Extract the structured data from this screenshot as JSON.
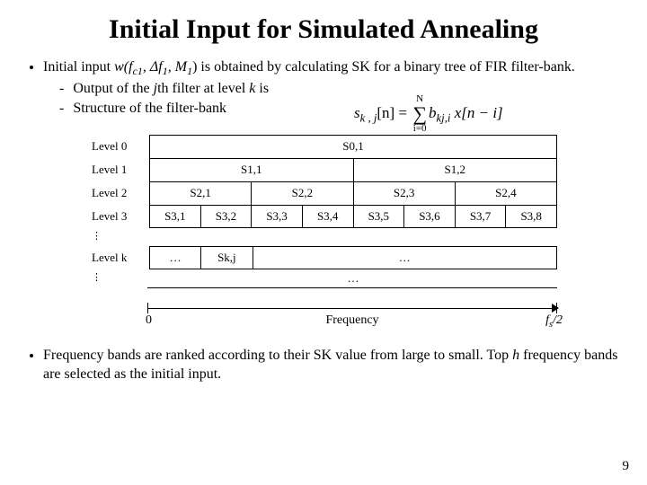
{
  "title": "Initial Input for Simulated Annealing",
  "bullets": {
    "b1_pre": "Initial input ",
    "b1_wf": "w(f",
    "b1_c1": "c1",
    "b1_mid1": ", Δf",
    "b1_one": "1",
    "b1_mid2": ", M",
    "b1_one2": "1",
    "b1_post": ") is obtained by calculating  SK for a binary tree of FIR filter-bank.",
    "s1_pre": "Output of the ",
    "s1_j": "j",
    "s1_mid": "th filter at level ",
    "s1_k": "k",
    "s1_post": " is",
    "s2": "Structure of the filter-bank",
    "b2": "Frequency bands are ranked according to their SK value from large to small. Top ",
    "b2_h": "h",
    "b2_post": " frequency bands  are selected as the initial input."
  },
  "eq": {
    "lhs_s": "s",
    "lhs_kj": "k , j",
    "lhs_n": "[n] = ",
    "sum_top": "N",
    "sum_bot": "i=0",
    "b": "b",
    "b_kji": "kj,i",
    "x": " x[n − i]"
  },
  "diagram": {
    "levels": [
      "Level 0",
      "Level 1",
      "Level 2",
      "Level 3",
      "Level k"
    ],
    "row0": [
      "S0,1"
    ],
    "row1": [
      "S1,1",
      "S1,2"
    ],
    "row2": [
      "S2,1",
      "S2,2",
      "S2,3",
      "S2,4"
    ],
    "row3": [
      "S3,1",
      "S3,2",
      "S3,3",
      "S3,4",
      "S3,5",
      "S3,6",
      "S3,7",
      "S3,8"
    ],
    "rowk": [
      "…",
      "Sk,j",
      "…"
    ],
    "vdots": "⋮",
    "hdots": "…",
    "axis": {
      "zero": "0",
      "freq": "Frequency",
      "fs": "f",
      "fs_sub": "s",
      "half": "/2"
    }
  },
  "pagenum": "9"
}
